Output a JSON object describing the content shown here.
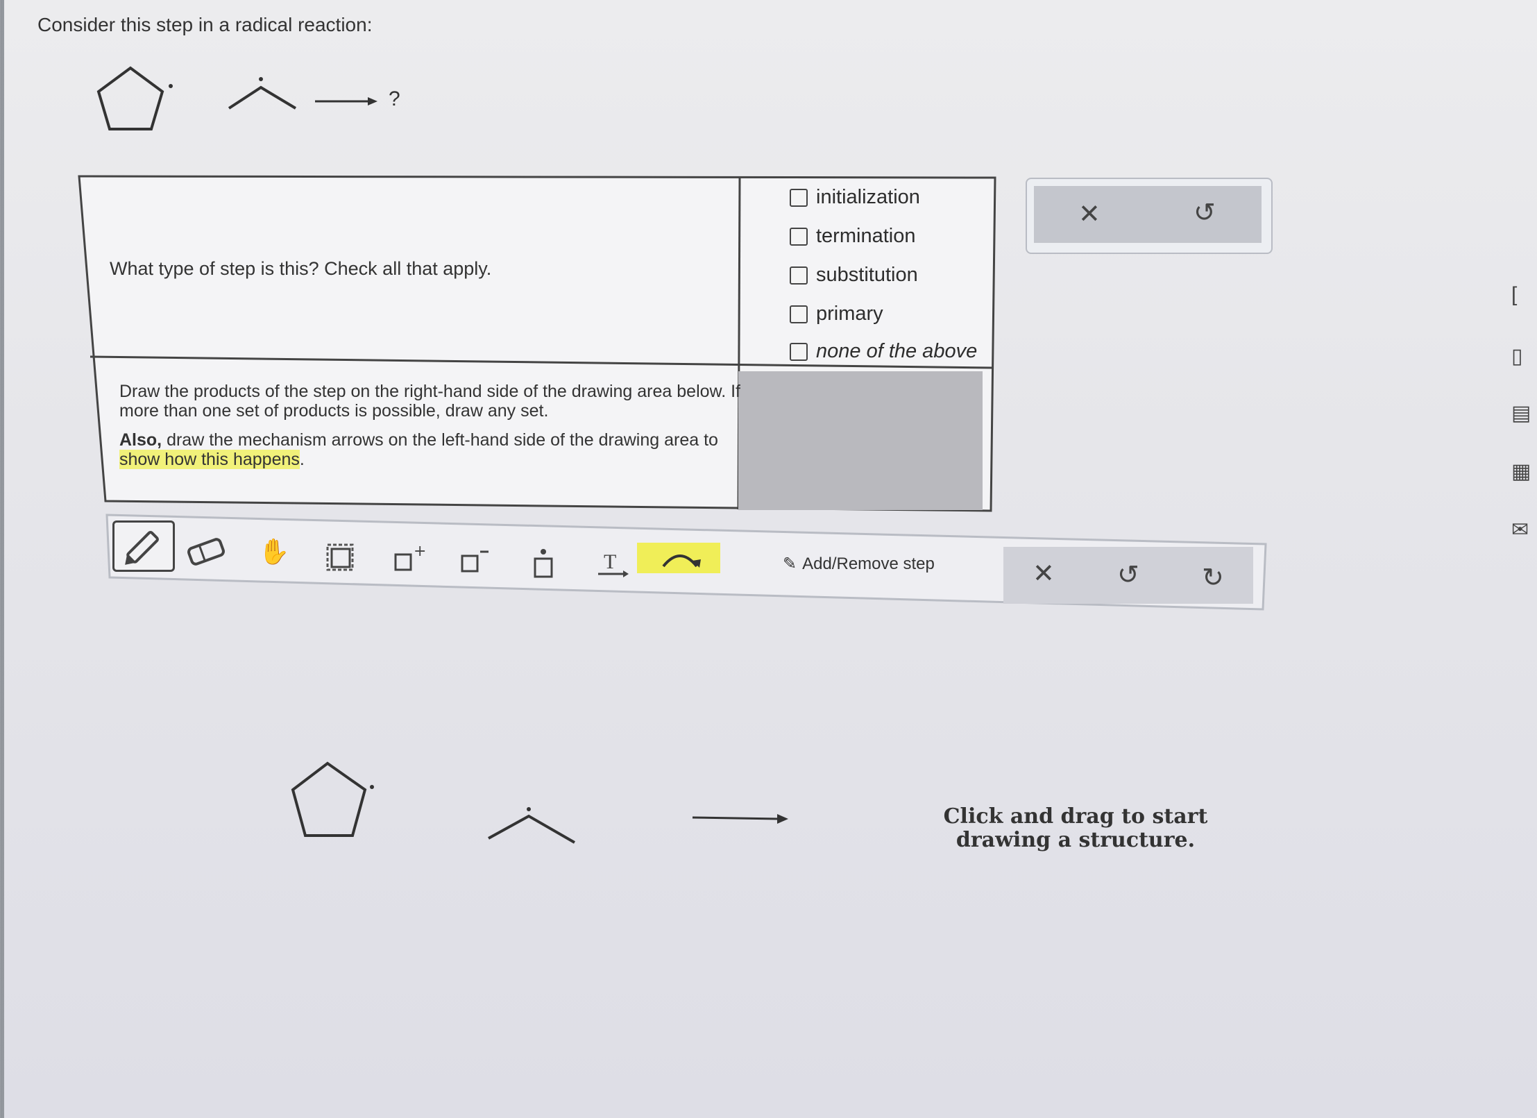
{
  "prompt": "Consider this step in a radical reaction:",
  "reaction": {
    "product_placeholder": "?"
  },
  "question1": {
    "text": "What type of step is this? Check all that apply.",
    "options": [
      {
        "label": "initialization",
        "checked": false
      },
      {
        "label": "termination",
        "checked": false
      },
      {
        "label": "substitution",
        "checked": false
      },
      {
        "label": "primary",
        "checked": false
      },
      {
        "label": "none of the above",
        "checked": false
      }
    ]
  },
  "question2": {
    "line1": "Draw the products of the step on the right-hand side of the drawing area below. If more than one set of products is possible, draw any set.",
    "also": "Also,",
    "line2_pre": " draw the mechanism arrows on the left-hand side of the drawing area to ",
    "line2_hl": "show how this happens",
    "line2_post": "."
  },
  "toolbar": {
    "tools": [
      "pencil-icon",
      "eraser-icon",
      "hand-icon",
      "select-box-icon",
      "increase-charge-icon",
      "decrease-charge-icon",
      "lone-pair-icon",
      "text-icon",
      "curved-arrow-icon"
    ],
    "add_remove_label": "Add/Remove step"
  },
  "controls": {
    "clear": "✕",
    "undo": "↺",
    "redo": "↻"
  },
  "canvas": {
    "hint": "Click and drag to start drawing a structure."
  },
  "colors": {
    "highlight": "#f1f17a",
    "selected_tool_bg": "#f0ee58",
    "control_panel": "#c4c6cd"
  }
}
